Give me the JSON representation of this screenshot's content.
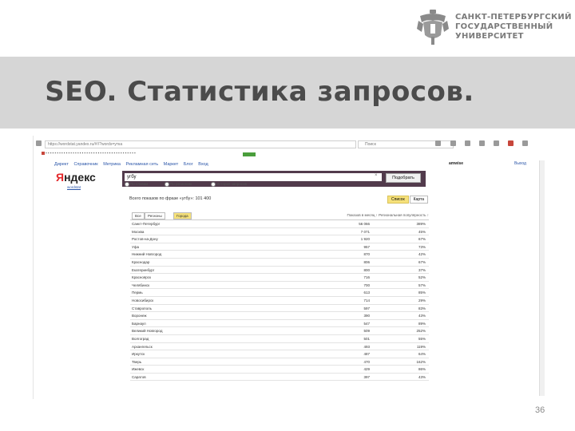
{
  "logo": {
    "lines": [
      "САНКТ-ПЕТЕРБУРГСКИЙ",
      "ГОСУДАРСТВЕННЫЙ",
      "УНИВЕРСИТЕТ"
    ]
  },
  "slide": {
    "title": "SEO. Статистика запросов.",
    "page_number": "36"
  },
  "browser": {
    "url": "https://wordstat.yandex.ru/#!/?words=утка",
    "search_placeholder": "Поиск"
  },
  "yandex_nav": {
    "items": [
      "Директ",
      "Справочник",
      "Метрика",
      "Рекламная сеть",
      "Маркет",
      "Блог",
      "Вход"
    ],
    "user": "amwise",
    "exit": "Выход"
  },
  "yandex": {
    "logo_y": "Я",
    "logo_rest": "ндекс",
    "subtitle": "wordstat",
    "query": "угбу",
    "search_button": "Подобрать",
    "radios": [
      "По словам",
      "По регионам",
      "История запросов"
    ],
    "total": "Всего показов по фразе «угбу»: 101 400",
    "view_tabs": [
      "Список",
      "Карта"
    ]
  },
  "table": {
    "tabs": [
      "Все",
      "Регионы",
      "Города"
    ],
    "col_headers": "Показов в месяц ↑ Региональная популярность ↑",
    "rows": [
      {
        "region": "Санкт-Петербург",
        "shows": "56 066",
        "pop": "389%"
      },
      {
        "region": "Москва",
        "shows": "7 071",
        "pop": "45%"
      },
      {
        "region": "Ростов-на-Дону",
        "shows": "1 920",
        "pop": "67%"
      },
      {
        "region": "Уфа",
        "shows": "957",
        "pop": "73%"
      },
      {
        "region": "Нижний Новгород",
        "shows": "870",
        "pop": "42%"
      },
      {
        "region": "Краснодар",
        "shows": "806",
        "pop": "67%"
      },
      {
        "region": "Екатеринбург",
        "shows": "800",
        "pop": "37%"
      },
      {
        "region": "Красноярск",
        "shows": "716",
        "pop": "52%"
      },
      {
        "region": "Челябинск",
        "shows": "700",
        "pop": "57%"
      },
      {
        "region": "Пермь",
        "shows": "613",
        "pop": "85%"
      },
      {
        "region": "Новосибирск",
        "shows": "714",
        "pop": "29%"
      },
      {
        "region": "Ставрополь",
        "shows": "597",
        "pop": "83%"
      },
      {
        "region": "Воронеж",
        "shows": "390",
        "pop": "43%"
      },
      {
        "region": "Барнаул",
        "shows": "547",
        "pop": "89%"
      },
      {
        "region": "Великий Новгород",
        "shows": "509",
        "pop": "252%"
      },
      {
        "region": "Волгоград",
        "shows": "501",
        "pop": "55%"
      },
      {
        "region": "Архангельск",
        "shows": "493",
        "pop": "119%"
      },
      {
        "region": "Иркутск",
        "shows": "487",
        "pop": "64%"
      },
      {
        "region": "Тверь",
        "shows": "470",
        "pop": "162%"
      },
      {
        "region": "Ижевск",
        "shows": "429",
        "pop": "86%"
      },
      {
        "region": "Саратов",
        "shows": "397",
        "pop": "43%"
      }
    ]
  },
  "colors": {
    "search_band": "#523b4c",
    "yandex_red": "#e3272a",
    "active_tab": "#f6e17a"
  }
}
